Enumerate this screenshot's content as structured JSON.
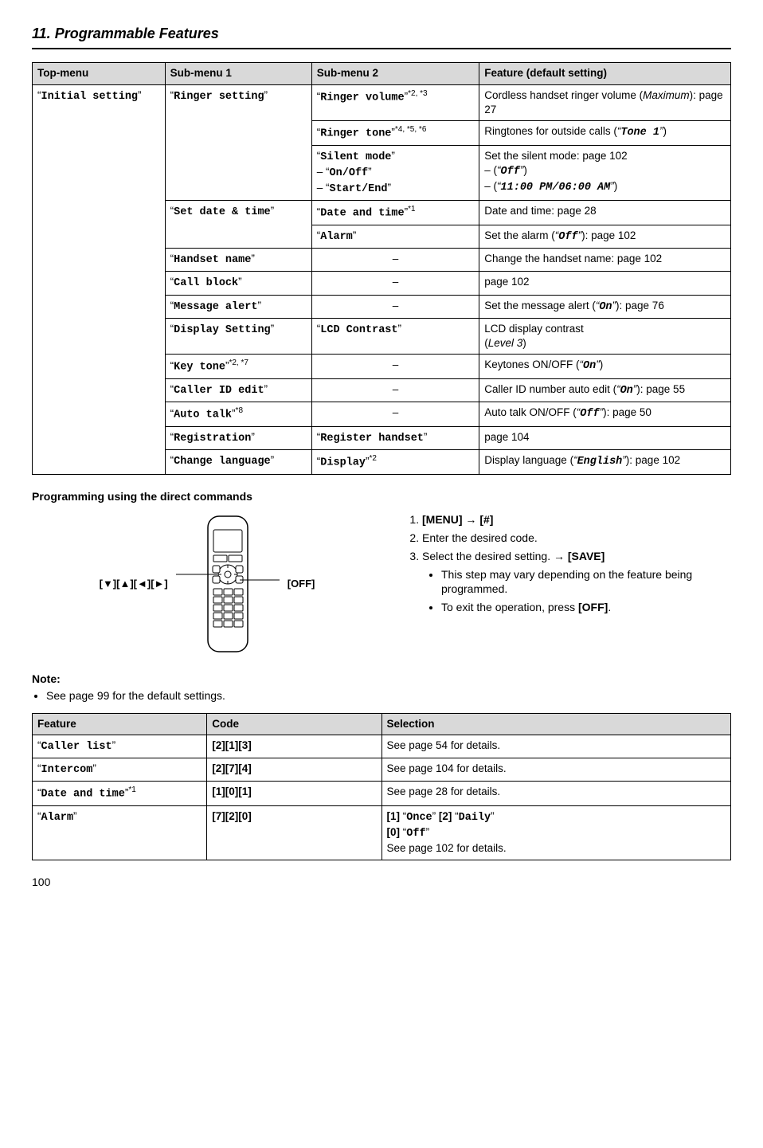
{
  "chapter": "11. Programmable Features",
  "table1": {
    "headers": [
      "Top-menu",
      "Sub-menu 1",
      "Sub-menu 2",
      "Feature (default setting)"
    ],
    "topmenu": "\"Initial setting\"",
    "rows": [
      {
        "sub1": "\"Ringer setting\"",
        "sub1_rowspan": 3,
        "sub2": "\"Ringer volume\"",
        "sub2_sup": "*2, *3",
        "feat": "Cordless handset ringer volume (Maximum): page 27"
      },
      {
        "sub2": "\"Ringer tone\"",
        "sub2_sup": "*4, *5, *6",
        "feat": "Ringtones for outside calls (\"Tone 1\")"
      },
      {
        "sub2": "\"Silent mode\"\n–   \"On/Off\"\n–   \"Start/End\"",
        "feat": "Set the silent mode: page 102\n–   (\"Off\")\n–   (\"11:00 PM/06:00 AM\")"
      },
      {
        "sub1": "\"Set date & time\"",
        "sub1_rowspan": 2,
        "sub2": "\"Date and time\"",
        "sub2_sup": "*1",
        "feat": "Date and time: page 28"
      },
      {
        "sub2": "\"Alarm\"",
        "feat": "Set the alarm (\"Off\"): page 102"
      },
      {
        "sub1": "\"Handset name\"",
        "sub2": "–",
        "sub2_center": true,
        "feat": "Change the handset name: page 102"
      },
      {
        "sub1": "\"Call block\"",
        "sub2": "–",
        "sub2_center": true,
        "feat": "page 102"
      },
      {
        "sub1": "\"Message alert\"",
        "sub2": "–",
        "sub2_center": true,
        "feat": "Set the message alert (\"On\"): page 76"
      },
      {
        "sub1": "\"Display Setting\"",
        "sub2": "\"LCD Contrast\"",
        "feat": "LCD display contrast\n(Level 3)"
      },
      {
        "sub1": "\"Key tone\"",
        "sub1_sup": "*2, *7",
        "sub2": "–",
        "sub2_center": true,
        "feat": "Keytones ON/OFF (\"On\")"
      },
      {
        "sub1": "\"Caller ID edit\"",
        "sub2": "–",
        "sub2_center": true,
        "feat": "Caller ID number auto edit (\"On\"): page 55"
      },
      {
        "sub1": "\"Auto talk\"",
        "sub1_sup": "*8",
        "sub2": "–",
        "sub2_center": true,
        "feat": "Auto talk ON/OFF (\"Off\"): page 50"
      },
      {
        "sub1": "\"Registration\"",
        "sub2": "\"Register handset\"",
        "feat": "page 104"
      },
      {
        "sub1": "\"Change language\"",
        "sub2": "\"Display\"",
        "sub2_sup": "*2",
        "feat": "Display language (\"English\"): page 102"
      }
    ]
  },
  "direct_heading": "Programming using the direct commands",
  "handset_label_left": "[▼][▲][◄][►]",
  "handset_label_right": "[OFF]",
  "steps": [
    "[MENU] → [#]",
    "Enter the desired code.",
    "Select the desired setting. → [SAVE]"
  ],
  "step3_bullets": [
    "This step may vary depending on the feature being programmed.",
    "To exit the operation, press [OFF]."
  ],
  "note_label": "Note:",
  "note_text": "See page 99 for the default settings.",
  "table2": {
    "headers": [
      "Feature",
      "Code",
      "Selection"
    ],
    "rows": [
      {
        "feat": "\"Caller list\"",
        "code": "[2][1][3]",
        "sel": "See page 54 for details."
      },
      {
        "feat": "\"Intercom\"",
        "code": "[2][7][4]",
        "sel": "See page 104 for details."
      },
      {
        "feat": "\"Date and time\"",
        "feat_sup": "*1",
        "code": "[1][0][1]",
        "sel": "See page 28 for details."
      },
      {
        "feat": "\"Alarm\"",
        "code": "[7][2][0]",
        "sel": "[1] \"Once\" [2] \"Daily\"\n[0] \"Off\"\nSee page 102 for details."
      }
    ]
  },
  "page_number": "100"
}
